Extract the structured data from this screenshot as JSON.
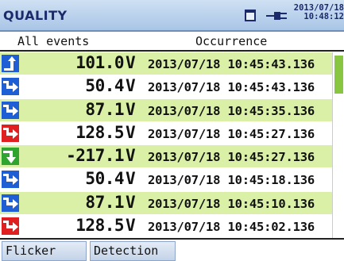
{
  "header": {
    "title": "QUALITY",
    "date": "2013/07/18",
    "time": "10:48:12"
  },
  "columns": {
    "events": "All events",
    "occurrence": "Occurrence"
  },
  "rows": [
    {
      "icon": "swell-up-arrow-icon",
      "color": "#1f5fd6",
      "value": "101.0",
      "unit": "V",
      "timestamp": "2013/07/18 10:45:43.136"
    },
    {
      "icon": "dip-down-arrow-icon",
      "color": "#1f5fd6",
      "value": "50.4",
      "unit": "V",
      "timestamp": "2013/07/18 10:45:43.136"
    },
    {
      "icon": "dip-down-arrow-icon",
      "color": "#1f5fd6",
      "value": "87.1",
      "unit": "V",
      "timestamp": "2013/07/18 10:45:35.136"
    },
    {
      "icon": "interruption-arrow-icon",
      "color": "#e02020",
      "value": "128.5",
      "unit": "V",
      "timestamp": "2013/07/18 10:45:27.136"
    },
    {
      "icon": "transient-arrow-icon",
      "color": "#2fa52f",
      "value": "-217.1",
      "unit": "V",
      "timestamp": "2013/07/18 10:45:27.136"
    },
    {
      "icon": "dip-down-arrow-icon",
      "color": "#1f5fd6",
      "value": "50.4",
      "unit": "V",
      "timestamp": "2013/07/18 10:45:18.136"
    },
    {
      "icon": "dip-down-arrow-icon",
      "color": "#1f5fd6",
      "value": "87.1",
      "unit": "V",
      "timestamp": "2013/07/18 10:45:10.136"
    },
    {
      "icon": "interruption-arrow-icon",
      "color": "#e02020",
      "value": "128.5",
      "unit": "V",
      "timestamp": "2013/07/18 10:45:02.136"
    }
  ],
  "tabs": [
    {
      "label": "Flicker"
    },
    {
      "label": "Detection"
    }
  ]
}
